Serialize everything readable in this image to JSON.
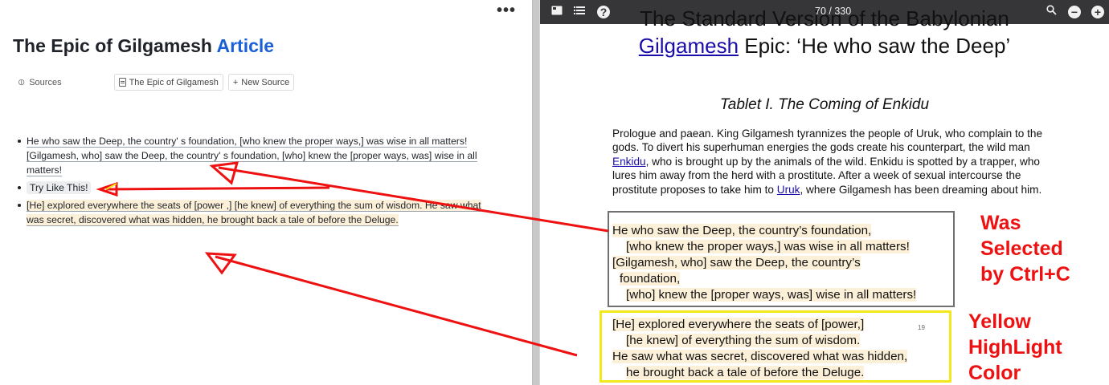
{
  "left_pane": {
    "more_label": "•••",
    "title_main": "The Epic of Gilgamesh",
    "title_accent": "Article",
    "sources_label": "Sources",
    "source_chip": "The Epic of Gilgamesh",
    "new_source_label": "New Source",
    "bullets": [
      "He who saw the Deep, the country' s foundation, [who knew the proper ways,] was wise in all matters! [Gilgamesh, who] saw the Deep, the country' s foundation, [who] knew the [proper ways, was] wise in all matters!",
      "Try Like This!",
      "[He] explored everywhere the seats of [power ,] [he knew] of everything the sum of wisdom. He saw what was secret, discovered what was hidden, he brought back a tale of before the Deluge."
    ]
  },
  "pdf_viewer": {
    "page_current": "70",
    "page_total": "330",
    "page_sep": "/",
    "title_cut": "The Standard Version of the Babylonian",
    "title_link": "Gilgamesh",
    "title_rest": " Epic: ‘He who saw the Deep’",
    "tablet_heading": "Tablet I. The Coming of Enkidu",
    "prologue_a": "Prologue and paean. King Gilgamesh tyrannizes the people of Uruk, who complain to the gods. To divert his superhuman energies the gods create his counterpart, the wild man ",
    "prologue_link1": "Enkidu",
    "prologue_b": ", who is brought up by the animals of the wild. Enkidu is spotted by a trapper, who lures him away from the herd with a prostitute. After a week of sexual intercourse the prostitute proposes to take him to ",
    "prologue_link2": "Uruk",
    "prologue_c": ", where Gilgamesh has been dreaming about him.",
    "selected_verse": [
      "He who saw the Deep, the country’s foundation,",
      "[who knew the proper ways,] was wise in all matters!",
      "[Gilgamesh, who] saw the Deep, the country’s",
      "foundation,",
      "[who] knew the [proper ways, was] wise in all matters!"
    ],
    "yellow_verse": [
      "[He] explored everywhere the seats of [power,]",
      "[he knew] of everything the sum of wisdom.",
      "He saw what was secret, discovered what was hidden,",
      "he brought back a tale of before the Deluge."
    ],
    "tiny_page_num": "19"
  },
  "annotations": {
    "selected_note": [
      "Was",
      "Selected",
      "by Ctrl+C"
    ],
    "yellow_note": [
      "Yellow",
      "HighLight",
      "Color"
    ]
  },
  "colors": {
    "highlight": "#fdf0d8",
    "annotation_red": "#ee1111",
    "yellow_box": "#f2e81c",
    "accent_blue": "#1a5fd6",
    "toolbar_bg": "#363638"
  }
}
